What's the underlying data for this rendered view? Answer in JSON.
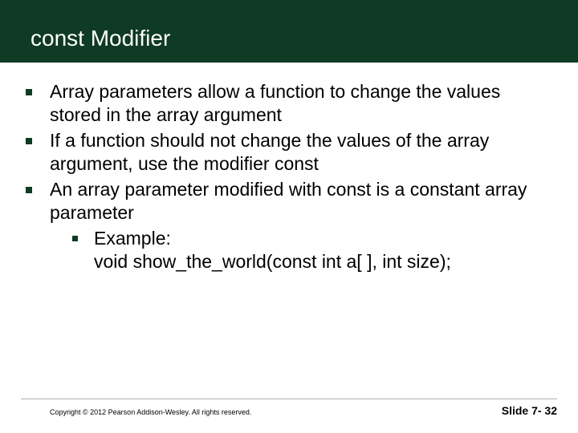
{
  "title": "const Modifier",
  "bullets": [
    {
      "text": "Array parameters allow a function to change the values stored in the array argument"
    },
    {
      "text": "If a function should not change the values of the array argument, use the modifier const"
    },
    {
      "text": "An array parameter modified with const is a constant array parameter"
    }
  ],
  "sub": {
    "label": "Example:",
    "code": "void show_the_world(const int a[ ], int size);"
  },
  "footer": {
    "copyright": "Copyright © 2012 Pearson Addison-Wesley.  All rights reserved.",
    "slide": "Slide 7- 32"
  }
}
